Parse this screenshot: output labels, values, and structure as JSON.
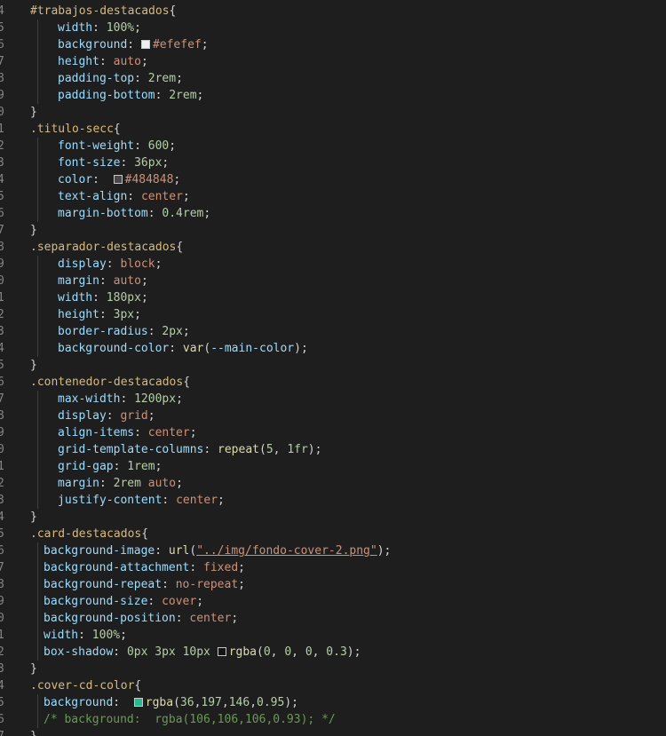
{
  "editor": {
    "lines": [
      {
        "ln": "4",
        "indent": 0,
        "parts": [
          {
            "c": "sel",
            "t": "#trabajos-destacados"
          },
          {
            "c": "",
            "t": "{"
          }
        ]
      },
      {
        "ln": "5",
        "indent": 2,
        "parts": [
          {
            "c": "prop",
            "t": "width"
          },
          {
            "c": "",
            "t": ": "
          },
          {
            "c": "num",
            "t": "100%"
          },
          {
            "c": "",
            "t": ";"
          }
        ]
      },
      {
        "ln": "6",
        "indent": 2,
        "parts": [
          {
            "c": "prop",
            "t": "background"
          },
          {
            "c": "",
            "t": ": "
          },
          {
            "swatch": "#efefef"
          },
          {
            "c": "kw",
            "t": "#efefef"
          },
          {
            "c": "",
            "t": ";"
          }
        ]
      },
      {
        "ln": "7",
        "indent": 2,
        "parts": [
          {
            "c": "prop",
            "t": "height"
          },
          {
            "c": "",
            "t": ": "
          },
          {
            "c": "kw",
            "t": "auto"
          },
          {
            "c": "",
            "t": ";"
          }
        ]
      },
      {
        "ln": "8",
        "indent": 2,
        "parts": [
          {
            "c": "prop",
            "t": "padding-top"
          },
          {
            "c": "",
            "t": ": "
          },
          {
            "c": "num",
            "t": "2rem"
          },
          {
            "c": "",
            "t": ";"
          }
        ]
      },
      {
        "ln": "9",
        "indent": 2,
        "parts": [
          {
            "c": "prop",
            "t": "padding-bottom"
          },
          {
            "c": "",
            "t": ": "
          },
          {
            "c": "num",
            "t": "2rem"
          },
          {
            "c": "",
            "t": ";"
          }
        ]
      },
      {
        "ln": "0",
        "indent": 0,
        "parts": [
          {
            "c": "",
            "t": "}"
          }
        ]
      },
      {
        "ln": "1",
        "indent": 0,
        "parts": [
          {
            "c": "sel",
            "t": ".titulo-secc"
          },
          {
            "c": "",
            "t": "{"
          }
        ]
      },
      {
        "ln": "2",
        "indent": 2,
        "parts": [
          {
            "c": "prop",
            "t": "font-weight"
          },
          {
            "c": "",
            "t": ": "
          },
          {
            "c": "num",
            "t": "600"
          },
          {
            "c": "",
            "t": ";"
          }
        ]
      },
      {
        "ln": "3",
        "indent": 2,
        "parts": [
          {
            "c": "prop",
            "t": "font-size"
          },
          {
            "c": "",
            "t": ": "
          },
          {
            "c": "num",
            "t": "36px"
          },
          {
            "c": "",
            "t": ";"
          }
        ]
      },
      {
        "ln": "4",
        "indent": 2,
        "parts": [
          {
            "c": "prop",
            "t": "color"
          },
          {
            "c": "",
            "t": ":  "
          },
          {
            "swatch": "#484848"
          },
          {
            "c": "kw",
            "t": "#484848"
          },
          {
            "c": "",
            "t": ";"
          }
        ]
      },
      {
        "ln": "5",
        "indent": 2,
        "parts": [
          {
            "c": "prop",
            "t": "text-align"
          },
          {
            "c": "",
            "t": ": "
          },
          {
            "c": "kw",
            "t": "center"
          },
          {
            "c": "",
            "t": ";"
          }
        ]
      },
      {
        "ln": "6",
        "indent": 2,
        "parts": [
          {
            "c": "prop",
            "t": "margin-bottom"
          },
          {
            "c": "",
            "t": ": "
          },
          {
            "c": "num",
            "t": "0.4rem"
          },
          {
            "c": "",
            "t": ";"
          }
        ]
      },
      {
        "ln": "7",
        "indent": 0,
        "parts": [
          {
            "c": "",
            "t": "}"
          }
        ]
      },
      {
        "ln": "8",
        "indent": 0,
        "parts": [
          {
            "c": "sel",
            "t": ".separador-destacados"
          },
          {
            "c": "",
            "t": "{"
          }
        ]
      },
      {
        "ln": "9",
        "indent": 2,
        "parts": [
          {
            "c": "prop",
            "t": "display"
          },
          {
            "c": "",
            "t": ": "
          },
          {
            "c": "kw",
            "t": "block"
          },
          {
            "c": "",
            "t": ";"
          }
        ]
      },
      {
        "ln": "0",
        "indent": 2,
        "parts": [
          {
            "c": "prop",
            "t": "margin"
          },
          {
            "c": "",
            "t": ": "
          },
          {
            "c": "kw",
            "t": "auto"
          },
          {
            "c": "",
            "t": ";"
          }
        ]
      },
      {
        "ln": "1",
        "indent": 2,
        "parts": [
          {
            "c": "prop",
            "t": "width"
          },
          {
            "c": "",
            "t": ": "
          },
          {
            "c": "num",
            "t": "180px"
          },
          {
            "c": "",
            "t": ";"
          }
        ]
      },
      {
        "ln": "2",
        "indent": 2,
        "parts": [
          {
            "c": "prop",
            "t": "height"
          },
          {
            "c": "",
            "t": ": "
          },
          {
            "c": "num",
            "t": "3px"
          },
          {
            "c": "",
            "t": ";"
          }
        ]
      },
      {
        "ln": "3",
        "indent": 2,
        "parts": [
          {
            "c": "prop",
            "t": "border-radius"
          },
          {
            "c": "",
            "t": ": "
          },
          {
            "c": "num",
            "t": "2px"
          },
          {
            "c": "",
            "t": ";"
          }
        ]
      },
      {
        "ln": "4",
        "indent": 2,
        "parts": [
          {
            "c": "prop",
            "t": "background-color"
          },
          {
            "c": "",
            "t": ": "
          },
          {
            "c": "fn",
            "t": "var"
          },
          {
            "c": "",
            "t": "("
          },
          {
            "c": "prop",
            "t": "--main-color"
          },
          {
            "c": "",
            "t": ");"
          }
        ]
      },
      {
        "ln": "5",
        "indent": 0,
        "parts": [
          {
            "c": "",
            "t": "}"
          }
        ]
      },
      {
        "ln": "6",
        "indent": 0,
        "parts": [
          {
            "c": "sel",
            "t": ".contenedor-destacados"
          },
          {
            "c": "",
            "t": "{"
          }
        ]
      },
      {
        "ln": "7",
        "indent": 2,
        "parts": [
          {
            "c": "prop",
            "t": "max-width"
          },
          {
            "c": "",
            "t": ": "
          },
          {
            "c": "num",
            "t": "1200px"
          },
          {
            "c": "",
            "t": ";"
          }
        ]
      },
      {
        "ln": "8",
        "indent": 2,
        "parts": [
          {
            "c": "prop",
            "t": "display"
          },
          {
            "c": "",
            "t": ": "
          },
          {
            "c": "kw",
            "t": "grid"
          },
          {
            "c": "",
            "t": ";"
          }
        ]
      },
      {
        "ln": "9",
        "indent": 2,
        "parts": [
          {
            "c": "prop",
            "t": "align-items"
          },
          {
            "c": "",
            "t": ": "
          },
          {
            "c": "kw",
            "t": "center"
          },
          {
            "c": "",
            "t": ";"
          }
        ]
      },
      {
        "ln": "0",
        "indent": 2,
        "parts": [
          {
            "c": "prop",
            "t": "grid-template-columns"
          },
          {
            "c": "",
            "t": ": "
          },
          {
            "c": "fn",
            "t": "repeat"
          },
          {
            "c": "",
            "t": "("
          },
          {
            "c": "num",
            "t": "5"
          },
          {
            "c": "",
            "t": ", "
          },
          {
            "c": "num",
            "t": "1fr"
          },
          {
            "c": "",
            "t": ");"
          }
        ]
      },
      {
        "ln": "1",
        "indent": 2,
        "parts": [
          {
            "c": "prop",
            "t": "grid-gap"
          },
          {
            "c": "",
            "t": ": "
          },
          {
            "c": "num",
            "t": "1rem"
          },
          {
            "c": "",
            "t": ";"
          }
        ]
      },
      {
        "ln": "2",
        "indent": 2,
        "parts": [
          {
            "c": "prop",
            "t": "margin"
          },
          {
            "c": "",
            "t": ": "
          },
          {
            "c": "num",
            "t": "2rem"
          },
          {
            "c": "",
            "t": " "
          },
          {
            "c": "kw",
            "t": "auto"
          },
          {
            "c": "",
            "t": ";"
          }
        ]
      },
      {
        "ln": "3",
        "indent": 2,
        "parts": [
          {
            "c": "prop",
            "t": "justify-content"
          },
          {
            "c": "",
            "t": ": "
          },
          {
            "c": "kw",
            "t": "center"
          },
          {
            "c": "",
            "t": ";"
          }
        ]
      },
      {
        "ln": "4",
        "indent": 0,
        "parts": [
          {
            "c": "",
            "t": "}"
          }
        ]
      },
      {
        "ln": "5",
        "indent": 0,
        "parts": [
          {
            "c": "sel",
            "t": ".card-destacados"
          },
          {
            "c": "",
            "t": "{"
          }
        ]
      },
      {
        "ln": "6",
        "indent": 1,
        "parts": [
          {
            "c": "prop",
            "t": "background-image"
          },
          {
            "c": "",
            "t": ": "
          },
          {
            "c": "fn",
            "t": "url"
          },
          {
            "c": "",
            "t": "("
          },
          {
            "c": "str",
            "t": "\"../img/fondo-cover-2.png\""
          },
          {
            "c": "",
            "t": ");"
          }
        ]
      },
      {
        "ln": "7",
        "indent": 1,
        "parts": [
          {
            "c": "prop",
            "t": "background-attachment"
          },
          {
            "c": "",
            "t": ": "
          },
          {
            "c": "kw",
            "t": "fixed"
          },
          {
            "c": "",
            "t": ";"
          }
        ]
      },
      {
        "ln": "8",
        "indent": 1,
        "parts": [
          {
            "c": "prop",
            "t": "background-repeat"
          },
          {
            "c": "",
            "t": ": "
          },
          {
            "c": "kw",
            "t": "no-repeat"
          },
          {
            "c": "",
            "t": ";"
          }
        ]
      },
      {
        "ln": "9",
        "indent": 1,
        "parts": [
          {
            "c": "prop",
            "t": "background-size"
          },
          {
            "c": "",
            "t": ": "
          },
          {
            "c": "kw",
            "t": "cover"
          },
          {
            "c": "",
            "t": ";"
          }
        ]
      },
      {
        "ln": "0",
        "indent": 1,
        "parts": [
          {
            "c": "prop",
            "t": "background-position"
          },
          {
            "c": "",
            "t": ": "
          },
          {
            "c": "kw",
            "t": "center"
          },
          {
            "c": "",
            "t": ";"
          }
        ]
      },
      {
        "ln": "1",
        "indent": 1,
        "parts": [
          {
            "c": "prop",
            "t": "width"
          },
          {
            "c": "",
            "t": ": "
          },
          {
            "c": "num",
            "t": "100%"
          },
          {
            "c": "",
            "t": ";"
          }
        ]
      },
      {
        "ln": "2",
        "indent": 1,
        "parts": [
          {
            "c": "prop",
            "t": "box-shadow"
          },
          {
            "c": "",
            "t": ": "
          },
          {
            "c": "num",
            "t": "0px"
          },
          {
            "c": "",
            "t": " "
          },
          {
            "c": "num",
            "t": "3px"
          },
          {
            "c": "",
            "t": " "
          },
          {
            "c": "num",
            "t": "10px"
          },
          {
            "c": "",
            "t": " "
          },
          {
            "swatch": "rgba(0,0,0,0.3)"
          },
          {
            "c": "fn",
            "t": "rgba"
          },
          {
            "c": "",
            "t": "("
          },
          {
            "c": "num",
            "t": "0"
          },
          {
            "c": "",
            "t": ", "
          },
          {
            "c": "num",
            "t": "0"
          },
          {
            "c": "",
            "t": ", "
          },
          {
            "c": "num",
            "t": "0"
          },
          {
            "c": "",
            "t": ", "
          },
          {
            "c": "num",
            "t": "0.3"
          },
          {
            "c": "",
            "t": ");"
          }
        ]
      },
      {
        "ln": "3",
        "indent": 0,
        "parts": [
          {
            "c": "",
            "t": "}"
          }
        ]
      },
      {
        "ln": "4",
        "indent": 0,
        "parts": [
          {
            "c": "sel",
            "t": ".cover-cd-color"
          },
          {
            "c": "",
            "t": "{"
          }
        ]
      },
      {
        "ln": "5",
        "indent": 1,
        "parts": [
          {
            "c": "prop",
            "t": "background"
          },
          {
            "c": "",
            "t": ":  "
          },
          {
            "swatch": "rgba(36,197,146,0.95)"
          },
          {
            "c": "fn",
            "t": "rgba"
          },
          {
            "c": "",
            "t": "("
          },
          {
            "c": "num",
            "t": "36"
          },
          {
            "c": "",
            "t": ","
          },
          {
            "c": "num",
            "t": "197"
          },
          {
            "c": "",
            "t": ","
          },
          {
            "c": "num",
            "t": "146"
          },
          {
            "c": "",
            "t": ","
          },
          {
            "c": "num",
            "t": "0.95"
          },
          {
            "c": "",
            "t": ");"
          }
        ]
      },
      {
        "ln": "6",
        "indent": 1,
        "parts": [
          {
            "c": "cm",
            "t": "/* background:  rgba(106,106,106,0.93); */"
          }
        ]
      },
      {
        "ln": "7",
        "indent": 0,
        "parts": [
          {
            "c": "",
            "t": "}"
          }
        ]
      }
    ]
  }
}
